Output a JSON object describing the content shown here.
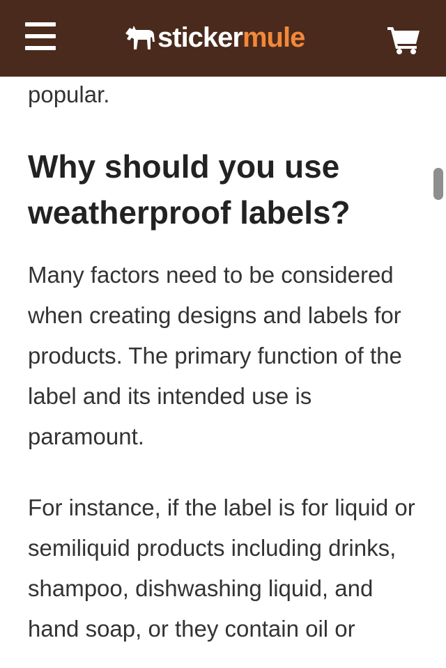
{
  "header": {
    "brand_part1": "sticker",
    "brand_part2": "mule",
    "background": "#4a2a1c",
    "brand_accent": "#f2883a",
    "menu_icon": "hamburger-menu-icon",
    "logo_icon": "mule-icon",
    "cart_icon": "shopping-cart-icon"
  },
  "article": {
    "fragment": "popular.",
    "heading": "Why should you use weatherproof labels?",
    "paragraphs": [
      "Many factors need to be considered when creating designs and labels for products. The primary function of the label and its intended use is paramount.",
      "For instance, if the label is for liquid or semiliquid products including drinks, shampoo, dishwashing liquid, and hand soap, or they contain oil or"
    ]
  }
}
